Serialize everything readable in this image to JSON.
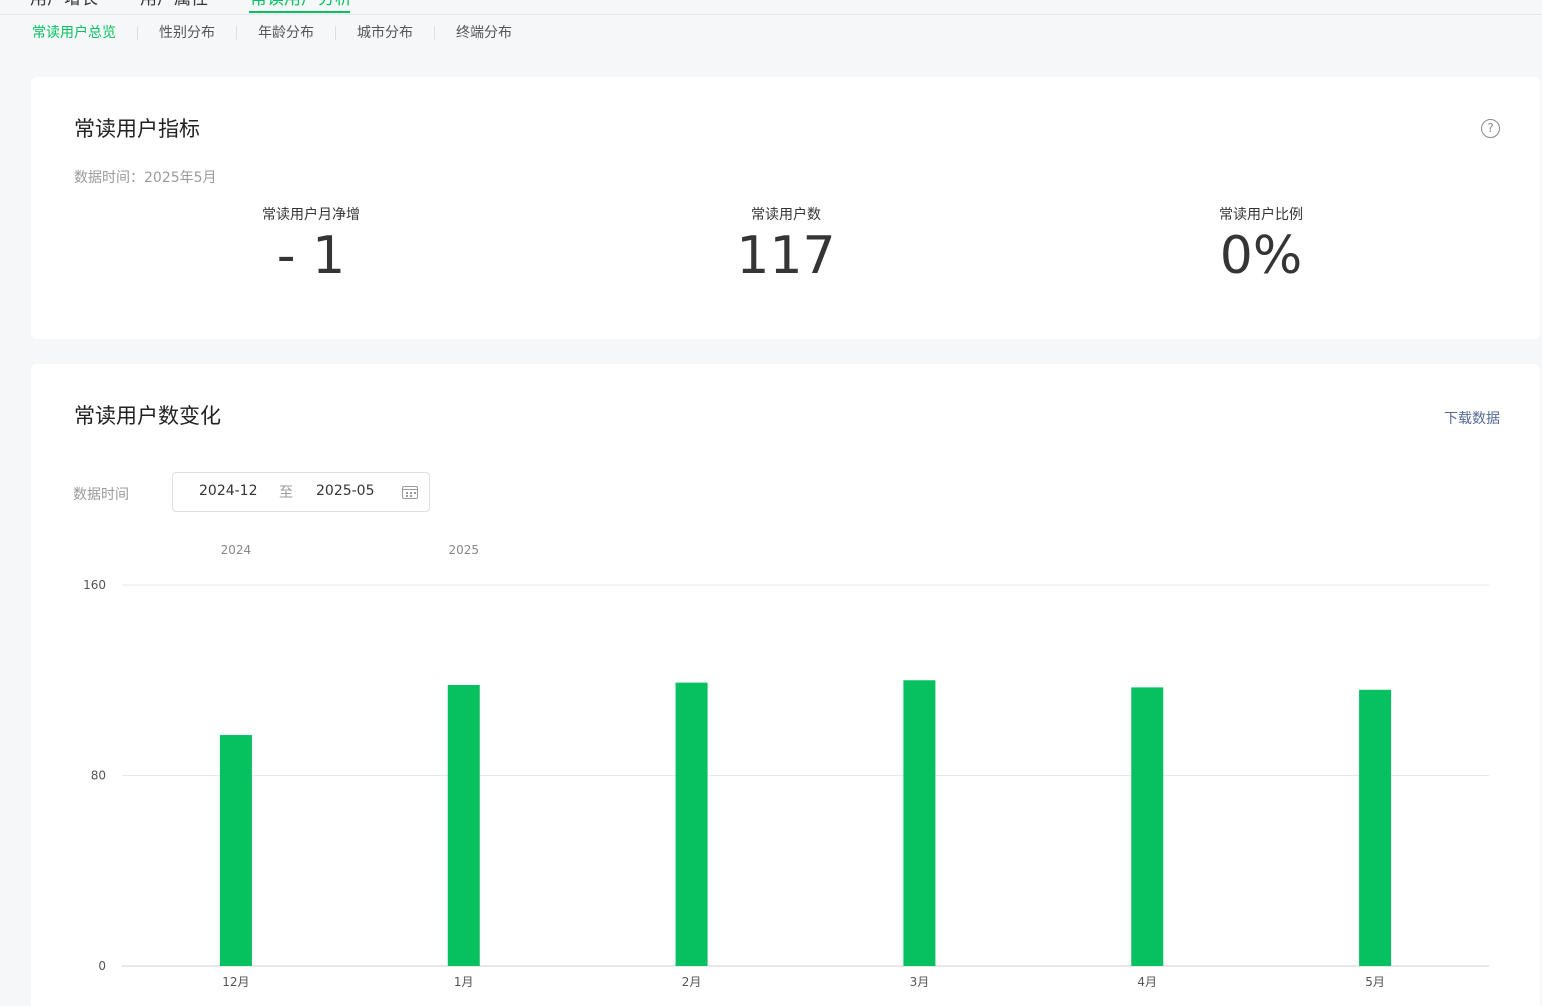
{
  "top_tabs": [
    {
      "label": "用户增长",
      "active": false
    },
    {
      "label": "用户属性",
      "active": false
    },
    {
      "label": "常读用户分析",
      "active": true
    }
  ],
  "sub_tabs": [
    {
      "label": "常读用户总览",
      "active": true
    },
    {
      "label": "性别分布",
      "active": false
    },
    {
      "label": "年龄分布",
      "active": false
    },
    {
      "label": "城市分布",
      "active": false
    },
    {
      "label": "终端分布",
      "active": false
    }
  ],
  "metrics_card": {
    "title": "常读用户指标",
    "help_icon": "question-circle-icon",
    "data_time": "数据时间：2025年5月",
    "metrics": [
      {
        "label": "常读用户月净增",
        "value": "- 1"
      },
      {
        "label": "常读用户数",
        "value": "117"
      },
      {
        "label": "常读用户比例",
        "value": "0%"
      }
    ]
  },
  "trend_card": {
    "title": "常读用户数变化",
    "download_label": "下载数据",
    "filter_label": "数据时间",
    "date_start": "2024-12",
    "date_sep": "至",
    "date_end": "2025-05",
    "calendar_icon": "calendar-icon"
  },
  "colors": {
    "accent": "#07c160",
    "link": "#576b95",
    "grid": "#e8e8e8"
  },
  "chart_data": {
    "type": "bar",
    "categories": [
      "12月",
      "1月",
      "2月",
      "3月",
      "4月",
      "5月"
    ],
    "year_labels": [
      {
        "label": "2024",
        "category_index": 0
      },
      {
        "label": "2025",
        "category_index": 1
      }
    ],
    "values": [
      97,
      118,
      119,
      120,
      117,
      116
    ],
    "yticks": [
      0,
      80,
      160
    ],
    "ylim": [
      0,
      160
    ],
    "grid": true,
    "title": "",
    "xlabel": "",
    "ylabel": ""
  }
}
